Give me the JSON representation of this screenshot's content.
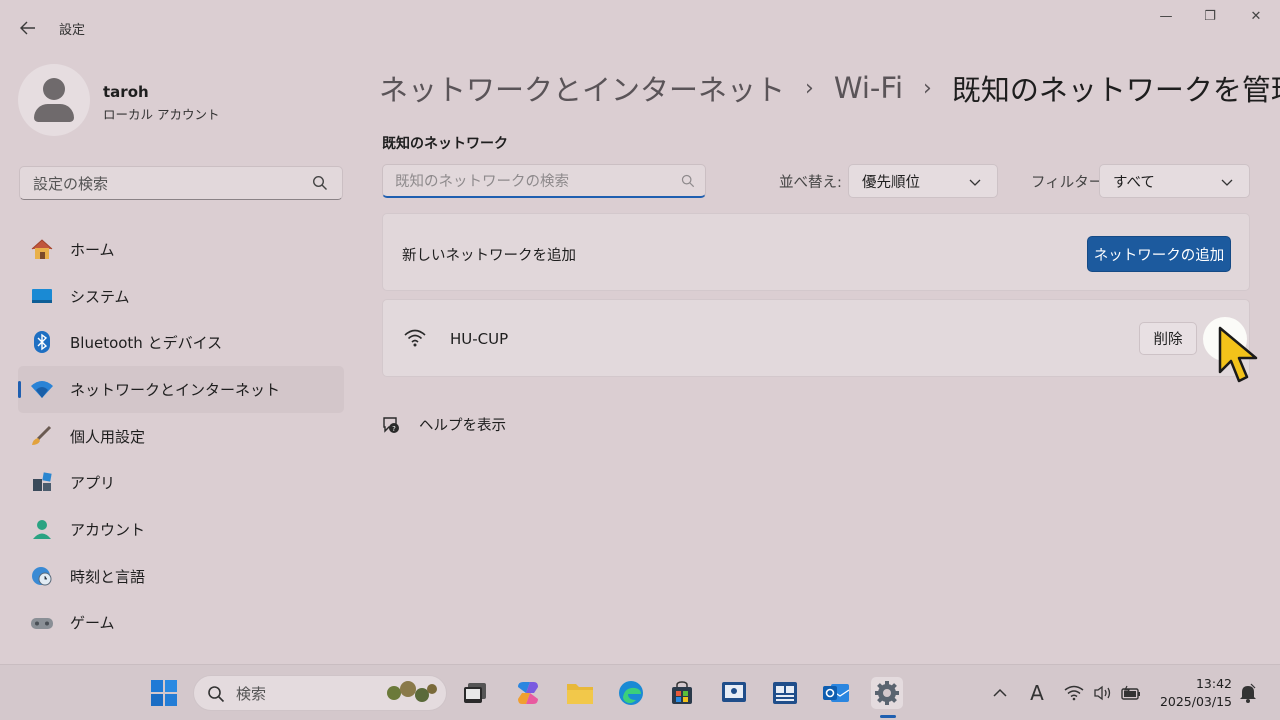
{
  "window": {
    "app_title": "設定",
    "controls": {
      "minimize": "—",
      "restore": "❐",
      "close": "✕"
    }
  },
  "profile": {
    "name": "taroh",
    "account_type": "ローカル アカウント"
  },
  "sidebar": {
    "search_placeholder": "設定の検索",
    "items": [
      {
        "label": "ホーム",
        "icon": "home-icon"
      },
      {
        "label": "システム",
        "icon": "system-icon"
      },
      {
        "label": "Bluetooth とデバイス",
        "icon": "bluetooth-icon"
      },
      {
        "label": "ネットワークとインターネット",
        "icon": "network-icon",
        "active": true
      },
      {
        "label": "個人用設定",
        "icon": "brush-icon"
      },
      {
        "label": "アプリ",
        "icon": "apps-icon"
      },
      {
        "label": "アカウント",
        "icon": "account-icon"
      },
      {
        "label": "時刻と言語",
        "icon": "time-language-icon"
      },
      {
        "label": "ゲーム",
        "icon": "gaming-icon"
      }
    ]
  },
  "breadcrumb": {
    "items": [
      "ネットワークとインターネット",
      "Wi-Fi",
      "既知のネットワークを管理"
    ],
    "separator": "›"
  },
  "main": {
    "section_title": "既知のネットワーク",
    "search_placeholder": "既知のネットワークの検索",
    "sort_label": "並べ替え:",
    "sort_value": "優先順位",
    "filter_label": "フィルター:",
    "filter_value": "すべて",
    "add_network": {
      "label": "新しいネットワークを追加",
      "button": "ネットワークの追加"
    },
    "networks": [
      {
        "name": "HU-CUP",
        "delete_label": "削除"
      }
    ],
    "help_label": "ヘルプを表示"
  },
  "taskbar": {
    "search_placeholder": "検索",
    "ime_indicator": "A",
    "time": "13:42",
    "date": "2025/03/15"
  },
  "colors": {
    "accent": "#1f5fb0",
    "primary_button": "#1c5a9e",
    "window_bg": "#dbced2"
  }
}
